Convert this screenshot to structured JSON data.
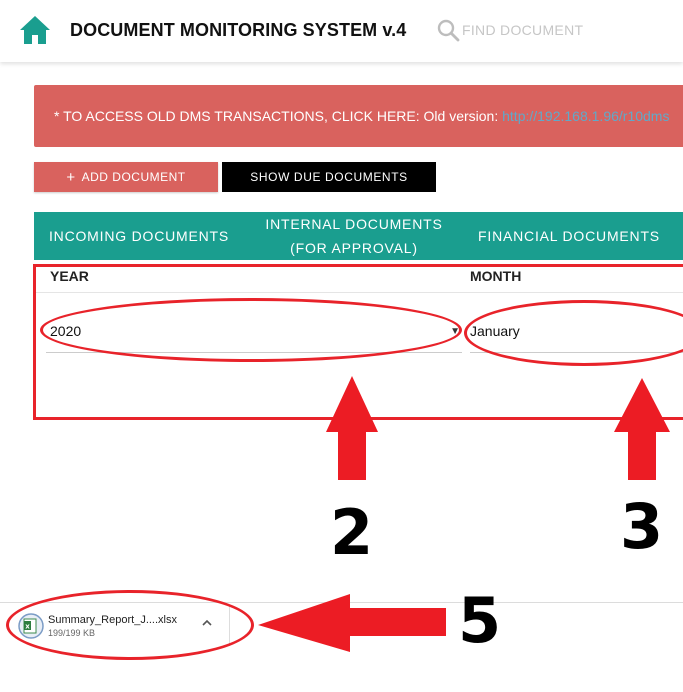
{
  "header": {
    "title": "DOCUMENT MONITORING SYSTEM v.4",
    "search_placeholder": "FIND DOCUMENT"
  },
  "alert": {
    "message": "* TO ACCESS OLD DMS TRANSACTIONS, CLICK HERE: Old version: ",
    "link": "http://192.168.1.96/r10dms"
  },
  "actions": {
    "add_label": "ADD DOCUMENT",
    "add_icon": "+",
    "due_label": "SHOW DUE DOCUMENTS"
  },
  "tabs": [
    {
      "label": "INCOMING DOCUMENTS"
    },
    {
      "label_line1": "INTERNAL DOCUMENTS",
      "label_line2": "(FOR APPROVAL)"
    },
    {
      "label": "FINANCIAL DOCUMENTS"
    }
  ],
  "filters": {
    "year_label": "YEAR",
    "year_value": "2020",
    "month_label": "MONTH",
    "month_value": "January"
  },
  "download": {
    "file_name": "Summary_Report_J....xlsx",
    "file_size": "199/199 KB"
  },
  "annotations": {
    "numbers": [
      "2",
      "3",
      "5"
    ],
    "color": "#e8232a"
  },
  "colors": {
    "accent_teal": "#1a9e8f",
    "alert_red": "#d9625e",
    "annotation_red": "#e8232a"
  }
}
